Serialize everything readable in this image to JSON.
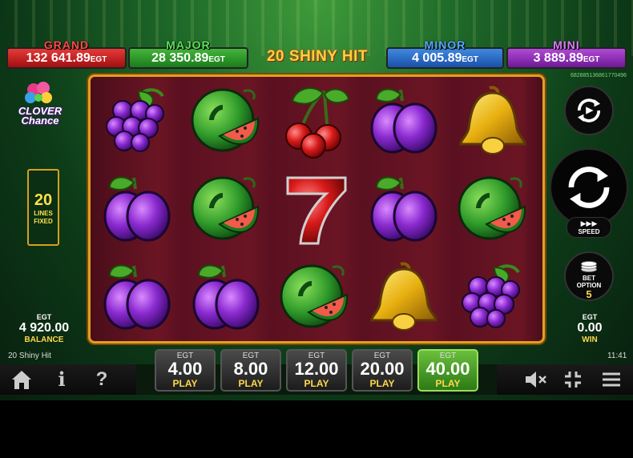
{
  "jackpots": [
    {
      "title": "GRAND",
      "value": "132 641.89",
      "currency": "EGT",
      "color": "#d62828"
    },
    {
      "title": "MAJOR",
      "value": "28 350.89",
      "currency": "EGT",
      "color": "#2e9a2a"
    },
    {
      "title": "MINOR",
      "value": "4 005.89",
      "currency": "EGT",
      "color": "#2a6ec8"
    },
    {
      "title": "MINI",
      "value": "3 889.89",
      "currency": "EGT",
      "color": "#8a2ab8"
    }
  ],
  "game_title": "20 SHINY HIT",
  "serial": "682885136861770496",
  "logo": {
    "line1": "CLOVER",
    "line2": "Chance"
  },
  "lines": {
    "count": "20",
    "label1": "LINES",
    "label2": "FIXED"
  },
  "balance": {
    "currency": "EGT",
    "amount": "4 920.00",
    "label": "BALANCE"
  },
  "win": {
    "currency": "EGT",
    "amount": "0.00",
    "label": "WIN"
  },
  "speed": {
    "label": "SPEED",
    "arrows": "▶▶▶"
  },
  "bet_option": {
    "label1": "BET",
    "label2": "OPTION",
    "value": "5"
  },
  "bets": [
    {
      "currency": "EGT",
      "value": "4.00",
      "label": "PLAY"
    },
    {
      "currency": "EGT",
      "value": "8.00",
      "label": "PLAY"
    },
    {
      "currency": "EGT",
      "value": "12.00",
      "label": "PLAY"
    },
    {
      "currency": "EGT",
      "value": "20.00",
      "label": "PLAY"
    },
    {
      "currency": "EGT",
      "value": "40.00",
      "label": "PLAY",
      "selected": true
    }
  ],
  "footer": {
    "game_name": "20 Shiny Hit",
    "clock": "11:41",
    "info": "i",
    "help": "?"
  },
  "reels": [
    [
      "grapes-icon",
      "plum-icon",
      "plum-icon"
    ],
    [
      "watermelon-icon",
      "watermelon-icon",
      "plum-icon"
    ],
    [
      "cherry-icon",
      "seven-icon",
      "watermelon-icon"
    ],
    [
      "plum-icon",
      "plum-icon",
      "bell-icon"
    ],
    [
      "bell-icon",
      "watermelon-icon",
      "grapes-icon"
    ]
  ]
}
